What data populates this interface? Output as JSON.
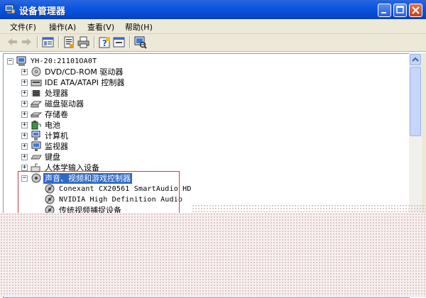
{
  "window": {
    "title": "设备管理器",
    "buttons": [
      "minimize",
      "maximize",
      "close"
    ]
  },
  "menu": [
    {
      "label": "文件(F)"
    },
    {
      "label": "操作(A)"
    },
    {
      "label": "查看(V)"
    },
    {
      "label": "帮助(H)"
    }
  ],
  "toolbar": {
    "items": [
      "back-icon",
      "forward-icon",
      "tree-view-icon",
      "properties-icon",
      "print-icon",
      "help-icon",
      "refresh-icon",
      "scan-hardware-icon"
    ]
  },
  "tree": {
    "root": "YH-20:21101OA0T",
    "categories": [
      {
        "label": "DVD/CD-ROM 驱动器",
        "icon": "dvd-drive-icon"
      },
      {
        "label": "IDE ATA/ATAPI 控制器",
        "icon": "ide-controller-icon"
      },
      {
        "label": "处理器",
        "icon": "processor-icon"
      },
      {
        "label": "磁盘驱动器",
        "icon": "disk-drive-icon"
      },
      {
        "label": "存储卷",
        "icon": "storage-volume-icon"
      },
      {
        "label": "电池",
        "icon": "battery-icon"
      },
      {
        "label": "计算机",
        "icon": "computer-icon"
      },
      {
        "label": "监视器",
        "icon": "monitor-icon"
      },
      {
        "label": "键盘",
        "icon": "keyboard-icon"
      },
      {
        "label": "人体学输入设备",
        "icon": "hid-icon"
      }
    ],
    "expanded": {
      "label": "声音、视频和游戏控制器",
      "children": [
        "Conexant CX20561 SmartAudio HD",
        "NVIDIA High Definition Audio",
        "传统视频捕捉设备"
      ]
    }
  },
  "colors": {
    "titlebar": "#0a57e2",
    "selection": "#316ac5",
    "highlight_box": "#d13a3a",
    "chrome": "#ece9d8"
  }
}
